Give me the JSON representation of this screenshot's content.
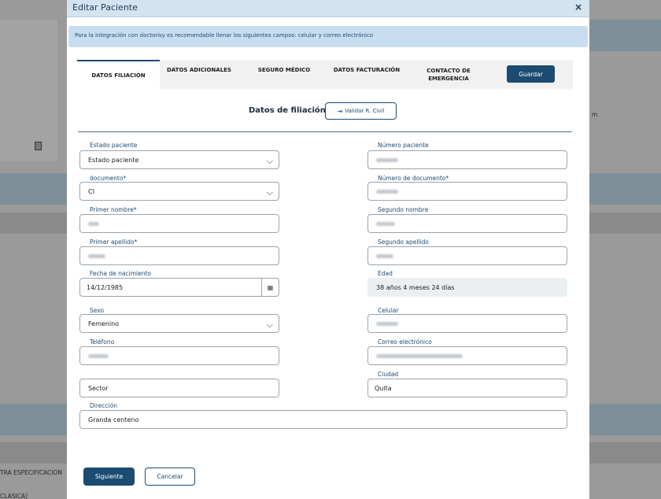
{
  "background": {
    "side_text_1": "m",
    "side_text_2": "TRA ESPECIFICACION",
    "side_text_3": "CLASICA]"
  },
  "modal": {
    "title": "Editar Paciente",
    "close_glyph": "×"
  },
  "alert": {
    "text": "Para la integración con doctorisy es recomendable llenar los siguientes campos: celular y correo electrónico"
  },
  "tabs": [
    {
      "label": "DATOS FILIACIÓN",
      "active": true
    },
    {
      "label": "DATOS ADICIONALES",
      "active": false
    },
    {
      "label": "SEGURO MÉDICO",
      "active": false
    },
    {
      "label": "DATOS FACTURACIÓN",
      "active": false
    },
    {
      "label": "CONTACTO DE EMERGENCIA",
      "active": false
    }
  ],
  "buttons": {
    "guardar": "Guardar",
    "validar": "Validar R. Civil",
    "siguiente": "Siguiente",
    "cancelar": "Cancelar"
  },
  "section_title": "Datos de filiación",
  "form": {
    "estado_paciente": {
      "label": "Estado paciente",
      "value": "Estado paciente"
    },
    "numero_paciente": {
      "label": "Número paciente",
      "value": ""
    },
    "documento": {
      "label": "documento*",
      "value": "CI"
    },
    "numero_documento": {
      "label": "Número de documento*",
      "value": ""
    },
    "primer_nombre": {
      "label": "Primer nombre*",
      "value": ""
    },
    "segundo_nombre": {
      "label": "Segundo nombre",
      "value": ""
    },
    "primer_apellido": {
      "label": "Primer apellido*",
      "value": ""
    },
    "segundo_apellido": {
      "label": "Segundo apellido",
      "value": ""
    },
    "fecha_nacimiento": {
      "label": "Fecha de nacimiento",
      "value": "14/12/1985"
    },
    "edad": {
      "label": "Edad",
      "value": "38 años 4 meses 24 días"
    },
    "sexo": {
      "label": "Sexo",
      "value": "Femenino"
    },
    "celular": {
      "label": "Celular",
      "value": ""
    },
    "telefono": {
      "label": "Teléfono",
      "value": ""
    },
    "correo": {
      "label": "Correo electrónico",
      "value": ""
    },
    "sector": {
      "label": "",
      "value": "Sector"
    },
    "ciudad": {
      "label": "Ciudad",
      "value": "Quita"
    },
    "direccion": {
      "label": "Dirección",
      "value": "Granda centeno"
    }
  },
  "icons": {
    "validar": "sign-in-icon",
    "calendar": "calendar-icon",
    "chevron": "chevron-down-icon",
    "trash": "trash-icon"
  }
}
